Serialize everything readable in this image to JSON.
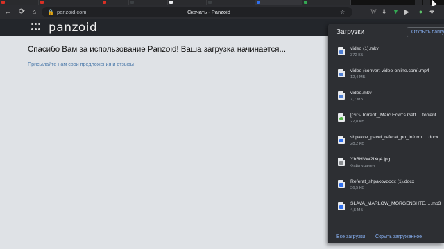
{
  "browser": {
    "url": "panzoid.com",
    "page_title": "Скачать - Panzoid",
    "tab_favicon_colors": [
      "#d93025",
      "#d93025",
      "#d93025",
      "#3c4043",
      "#e8eaed",
      "#3c4043",
      "#2f6fed",
      "#34a853"
    ],
    "extension_icons": [
      "wikipedia-icon",
      "download-arrow-icon",
      "extension-icon",
      "puzzle-icon"
    ]
  },
  "header": {
    "logo": "panzoid"
  },
  "main": {
    "headline": "Спасибо Вам за использование Panzoid! Ваша загрузка начинается...",
    "feedback_link": "Присылайте нам свои предложения и отзывы"
  },
  "downloads": {
    "title": "Загрузки",
    "open_folder": "Открыть папку",
    "items": [
      {
        "name": "video (1).mkv",
        "size": "372 КБ",
        "icon": "file-video-icon",
        "mark": "#4f7fd4"
      },
      {
        "name": "video (convert-video-online.com).mp4",
        "size": "12,4 МБ",
        "icon": "file-video-icon",
        "mark": "#4f7fd4"
      },
      {
        "name": "video.mkv",
        "size": "7,7 МБ",
        "icon": "file-video-icon",
        "mark": "#4f7fd4"
      },
      {
        "name": "[GiG-Torrent]_Marc Ecko's Gett.....torrent",
        "size": "22,8 КБ",
        "icon": "torrent-file-icon",
        "mark": "#55b748"
      },
      {
        "name": "shpakov_pavel_referat_po_Inform.....docx",
        "size": "28,2 КБ",
        "icon": "word-doc-icon",
        "mark": "#2f6fed"
      },
      {
        "name": "YhBHVW2IXq4.jpg",
        "size": "Файл удален",
        "icon": "image-file-icon",
        "mark": "#8a8d91"
      },
      {
        "name": "Referat_shpakovdocx (1).docx",
        "size": "36,5 КБ",
        "icon": "word-doc-icon",
        "mark": "#2f6fed"
      },
      {
        "name": "SLAVA_MARLOW_MORGENSHTE.....mp3",
        "size": "4,5 МБ",
        "icon": "audio-file-icon",
        "mark": "#2f6fed"
      }
    ],
    "show_all": "Все загрузки",
    "hide": "Скрыть загруженное"
  }
}
